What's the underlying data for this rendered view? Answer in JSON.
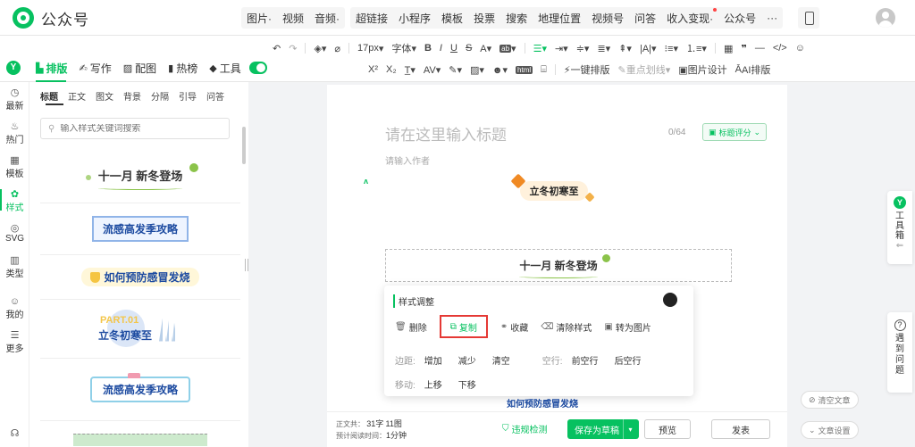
{
  "app": {
    "logo_text": "公众号"
  },
  "topnav": {
    "group1": [
      "图片·",
      "视频",
      "音频·"
    ],
    "group2": [
      "超链接",
      "小程序",
      "模板",
      "投票",
      "搜索",
      "地理位置",
      "视频号",
      "问答",
      "收入变现·",
      "公众号",
      "···"
    ]
  },
  "toolbar": {
    "font_size": "17px",
    "font_family": "字体",
    "row2": {
      "one_click": "一键排版",
      "highlight": "重点划线",
      "image_design": "图片设计",
      "ai_layout": "AI排版"
    }
  },
  "sidebar_tabs": [
    {
      "icon": "layout-icon",
      "label": "排版",
      "active": true
    },
    {
      "icon": "pen-icon",
      "label": "写作",
      "active": false
    },
    {
      "icon": "picture-icon",
      "label": "配图",
      "active": false
    },
    {
      "icon": "bookmark-icon",
      "label": "热榜",
      "active": false
    },
    {
      "icon": "cube-icon",
      "label": "工具",
      "active": false
    }
  ],
  "rail": [
    {
      "icon": "clock-icon",
      "glyph": "◷",
      "label": "最新"
    },
    {
      "icon": "fire-icon",
      "glyph": "♨",
      "label": "热门"
    },
    {
      "icon": "template-icon",
      "glyph": "▦",
      "label": "模板"
    },
    {
      "icon": "style-icon",
      "glyph": "✿",
      "label": "样式",
      "active": true
    },
    {
      "icon": "svg-icon",
      "glyph": "◎",
      "label": "SVG"
    },
    {
      "icon": "category-icon",
      "glyph": "▥",
      "label": "类型"
    },
    {
      "icon": "user-icon",
      "glyph": "☺",
      "label": "我的"
    },
    {
      "icon": "more-icon",
      "glyph": "☰",
      "label": "更多"
    }
  ],
  "panel": {
    "tabs": [
      "标题",
      "正文",
      "图文",
      "背景",
      "分隔",
      "引导",
      "问答"
    ],
    "search_placeholder": "输入样式关键词搜索",
    "cards": {
      "c1": "十一月 新冬登场",
      "c2": "流感高发季攻略",
      "c3": "如何预防感冒发烧",
      "c4_part": "PART.01",
      "c4_title": "立冬初寒至",
      "c5": "流感高发季攻略"
    }
  },
  "editor": {
    "title_placeholder": "请在这里输入标题",
    "title_count": "0/64",
    "score_button": "标题评分",
    "author_placeholder": "请输入作者",
    "banner_text": "立冬初寒至",
    "selected_text": "十一月 新冬登场",
    "under_text": "如何预防感冒发烧"
  },
  "popup": {
    "title": "样式调整",
    "actions": [
      {
        "icon": "trash-icon",
        "glyph": "🗑",
        "label": "删除"
      },
      {
        "icon": "copy-icon",
        "glyph": "⧉",
        "label": "复制"
      },
      {
        "icon": "collect-icon",
        "glyph": "⚭",
        "label": "收藏"
      },
      {
        "icon": "eraser-icon",
        "glyph": "⌫",
        "label": "清除样式"
      },
      {
        "icon": "to-image-icon",
        "glyph": "▣",
        "label": "转为图片"
      }
    ],
    "margin_label": "边距:",
    "margin_increase": "增加",
    "margin_decrease": "减少",
    "margin_clear": "清空",
    "space_label": "空行:",
    "space_before": "前空行",
    "space_after": "后空行",
    "move_label": "移动:",
    "move_up": "上移",
    "move_down": "下移"
  },
  "bottombar": {
    "stats_label": "正文共：",
    "char_count": "31字",
    "image_count": "11图",
    "read_label": "预计阅读时间：",
    "read_time": "1分钟",
    "check": "违规检测",
    "save": "保存为草稿",
    "preview": "预览",
    "publish": "发表"
  },
  "floats": {
    "toolbox": [
      "工",
      "具",
      "箱"
    ],
    "help": [
      "遇",
      "到",
      "问",
      "题"
    ],
    "clear_article": "清空文章",
    "article_settings": "文章设置"
  },
  "colors": {
    "brand": "#07c160",
    "highlight_border": "#e53935"
  }
}
